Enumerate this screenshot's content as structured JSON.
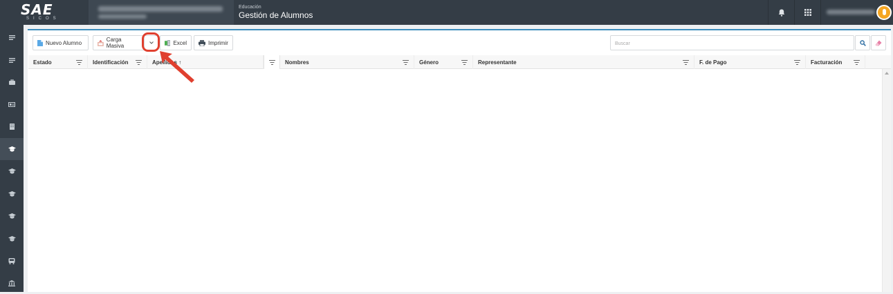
{
  "header": {
    "logo_text": "SAE",
    "logo_subtext": "SICOS",
    "module_category": "Educación",
    "module_title": "Gestión de Alumnos",
    "icons": [
      "bell-icon",
      "apps-grid-icon"
    ]
  },
  "sidebar": {
    "items": [
      {
        "icon": "list-icon"
      },
      {
        "icon": "list-icon"
      },
      {
        "icon": "briefcase-icon"
      },
      {
        "icon": "id-card-icon"
      },
      {
        "icon": "building-icon"
      },
      {
        "icon": "graduation-cap-icon",
        "active": true
      },
      {
        "icon": "graduation-cap-icon"
      },
      {
        "icon": "graduation-cap-icon"
      },
      {
        "icon": "graduation-cap-icon"
      },
      {
        "icon": "graduation-cap-icon"
      },
      {
        "icon": "bus-icon"
      },
      {
        "icon": "bank-icon"
      }
    ]
  },
  "toolbar": {
    "new_student_label": "Nuevo Alumno",
    "bulk_upload_label": "Carga Masiva",
    "excel_label": "Excel",
    "print_label": "Imprimir",
    "search_placeholder": "Buscar"
  },
  "grid": {
    "columns": [
      "Estado",
      "Identificación",
      "Apellidos",
      "Nombres",
      "Género",
      "Representante",
      "F. de Pago",
      "Facturación"
    ],
    "sort_indicator": "↑",
    "rows": []
  },
  "colors": {
    "topbar": "#343d46",
    "accent": "#3c8dbc",
    "annotation": "#e0402f",
    "avatar": "#f5a623"
  }
}
